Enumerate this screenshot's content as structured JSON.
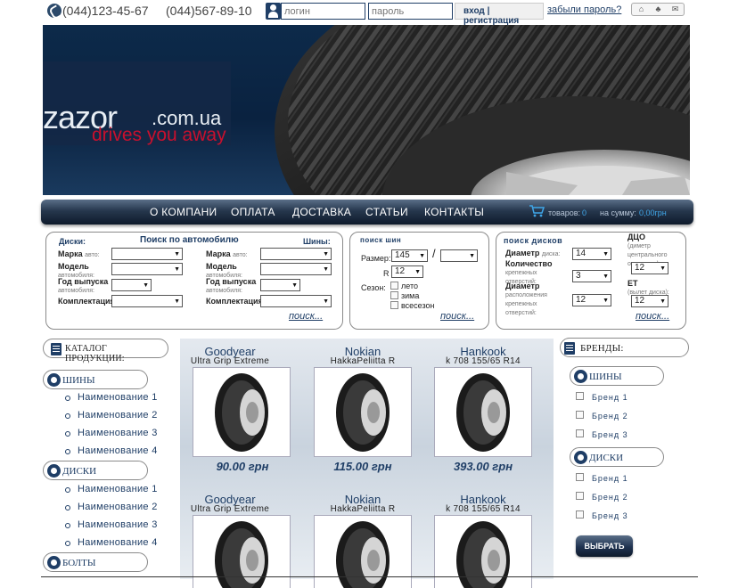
{
  "header": {
    "phone1": "(044)123-45-67",
    "phone2": "(044)567-89-10",
    "login_placeholder": "логин",
    "password_placeholder": "пароль",
    "login_label": "вход",
    "separator": "|",
    "register_label": "регистрация",
    "forgot_label": "забыли пароль?",
    "icons": [
      "home-icon",
      "sitemap-icon",
      "mail-icon"
    ]
  },
  "banner": {
    "logo_main": "zazor",
    "logo_suffix": ".com.ua",
    "logo_tagline": "drives you away"
  },
  "nav": {
    "items": [
      "О КОМПАНИ",
      "ОПЛАТА",
      "ДОСТАВКА",
      "СТАТЬИ",
      "КОНТАКТЫ"
    ],
    "cart_goods_label": "товаров:",
    "cart_goods_value": "0",
    "cart_sum_label": "на сумму:",
    "cart_sum_value": "0,00грн"
  },
  "auto_search": {
    "disks_label": "Диски:",
    "title": "Поиск по автомобилю",
    "tires_label": "Шины:",
    "left_labels": [
      "Марка",
      "Модель",
      "Год выпуска",
      "Комплектация"
    ],
    "left_sub": [
      "авто:",
      "автомобиля:",
      "автомобиля:",
      ""
    ],
    "right_labels": [
      "Марка",
      "Модель",
      "Год выпуска",
      "Комплектация"
    ],
    "right_sub": [
      "авто:",
      "автомобиля:",
      "автомобиля:",
      ""
    ],
    "link": "поиск..."
  },
  "tire_search": {
    "title": "поиск шин",
    "size_label": "Размер:",
    "width_value": "145",
    "slash": "/",
    "profile_value": "",
    "r_label": "R",
    "r_value": "12",
    "season_label": "Сезон:",
    "seasons": [
      "лето",
      "зима",
      "всесезон"
    ],
    "link": "поиск..."
  },
  "disk_search": {
    "title": "поиск дисков",
    "diameter_label": "Диаметр",
    "diameter_sub": "диска:",
    "diameter_value": "14",
    "count_label": "Количество",
    "count_sub": "крепежных отверстий:",
    "count_value": "3",
    "pcd_label": "Диаметр",
    "pcd_sub": "расположения крепежных отверстий:",
    "pcd_value": "12",
    "dco_label": "ДЦО",
    "dco_sub": "(диметр центрального отверстия):",
    "dco_value": "12",
    "et_label": "ET",
    "et_sub": "(вылет диска):",
    "et_value": "12",
    "link": "поиск..."
  },
  "catalog": {
    "title": "КАТАЛОГ ПРОДУКЦИИ:",
    "sections": [
      {
        "label": "ШИНЫ",
        "items": [
          "Наименование 1",
          "Наименование 2",
          "Наименование 3",
          "Наименование 4"
        ]
      },
      {
        "label": "ДИСКИ",
        "items": [
          "Наименование 1",
          "Наименование 2",
          "Наименование 3",
          "Наименование 4"
        ]
      },
      {
        "label": "БОЛТЫ",
        "items": []
      }
    ]
  },
  "products": [
    {
      "brand": "Goodyear",
      "model": "Ultra Grip Extreme",
      "price": "90.00 грн"
    },
    {
      "brand": "Nokian",
      "model": "HakkaPeliitta R",
      "price": "115.00 грн"
    },
    {
      "brand": "Hankook",
      "model": "k 708 155/65 R14",
      "price": "393.00 грн"
    },
    {
      "brand": "Goodyear",
      "model": "Ultra Grip Extreme",
      "price": ""
    },
    {
      "brand": "Nokian",
      "model": "HakkaPeliitta R",
      "price": ""
    },
    {
      "brand": "Hankook",
      "model": "k 708 155/65 R14",
      "price": ""
    }
  ],
  "brands": {
    "title": "БРЕНДЫ:",
    "sections": [
      {
        "label": "ШИНЫ",
        "items": [
          "Бренд 1",
          "Бренд 2",
          "Бренд 3"
        ]
      },
      {
        "label": "ДИСКИ",
        "items": [
          "Бренд 1",
          "Бренд 2",
          "Бренд 3"
        ]
      }
    ],
    "button": "ВЫБРАТЬ"
  },
  "colors": {
    "accent": "#1f3e66",
    "brand_red": "#c8102e",
    "cart_value": "#3fa6e8"
  }
}
